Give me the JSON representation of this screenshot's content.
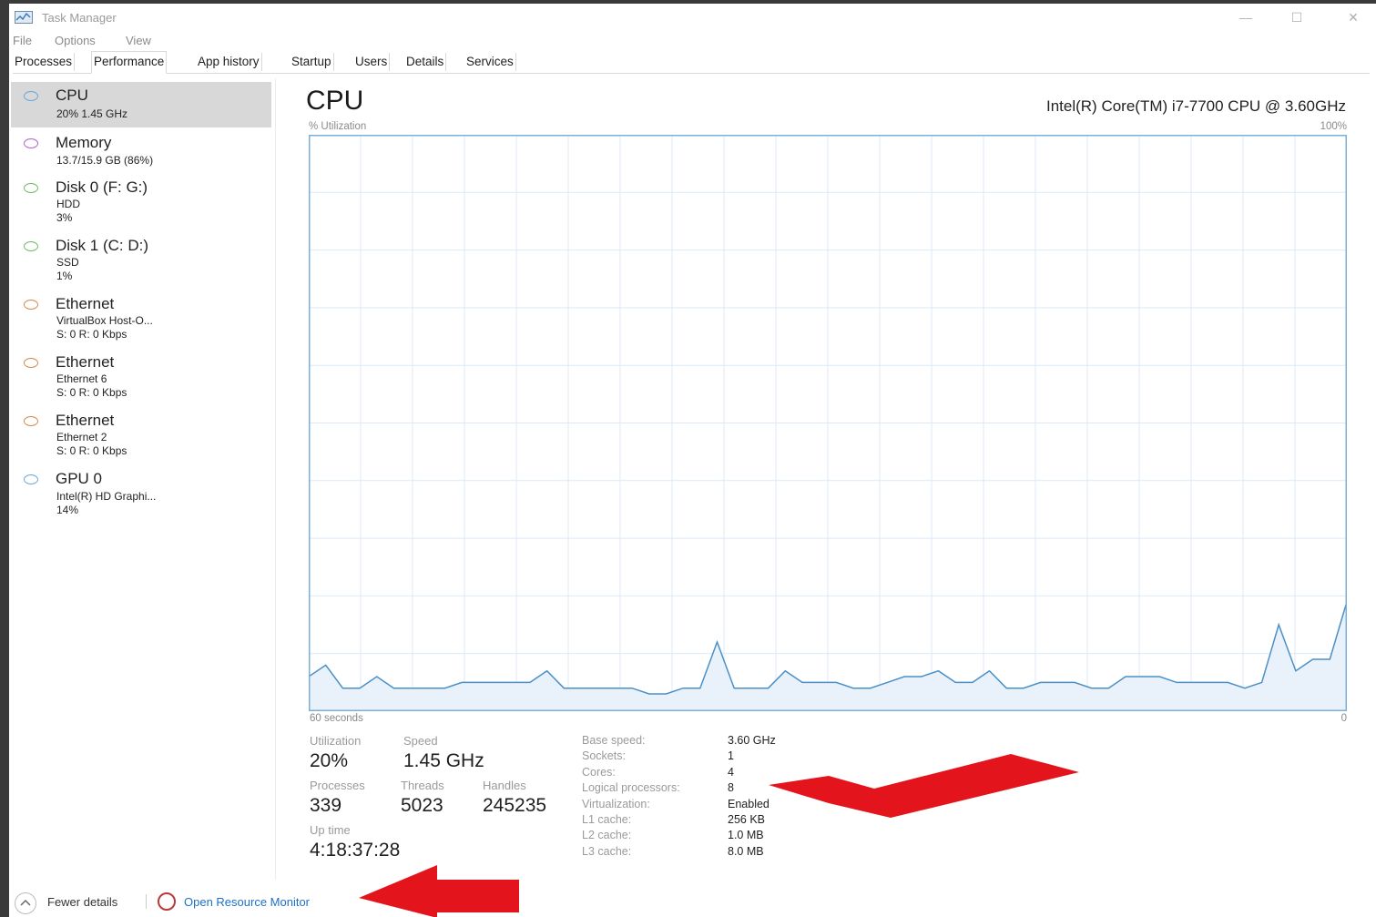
{
  "window": {
    "title": "Task Manager"
  },
  "menu": [
    "File",
    "Options",
    "View"
  ],
  "tabs": [
    "Processes",
    "Performance",
    "App history",
    "Startup",
    "Users",
    "Details",
    "Services"
  ],
  "sidebar": {
    "items": [
      {
        "title": "CPU",
        "lines": [
          "20%  1.45 GHz"
        ],
        "color": "#6aa8dc",
        "selected": true
      },
      {
        "title": "Memory",
        "lines": [
          "13.7/15.9 GB (86%)"
        ],
        "color": "#b45fd0"
      },
      {
        "title": "Disk 0 (F: G:)",
        "lines": [
          "HDD",
          "3%"
        ],
        "color": "#6cbf5f"
      },
      {
        "title": "Disk 1 (C: D:)",
        "lines": [
          "SSD",
          "1%"
        ],
        "color": "#6cbf5f"
      },
      {
        "title": "Ethernet",
        "lines": [
          "VirtualBox Host-O...",
          "S: 0 R: 0 Kbps"
        ],
        "color": "#d68a4c"
      },
      {
        "title": "Ethernet",
        "lines": [
          "Ethernet 6",
          "S: 0 R: 0 Kbps"
        ],
        "color": "#d68a4c"
      },
      {
        "title": "Ethernet",
        "lines": [
          "Ethernet 2",
          "S: 0 R: 0 Kbps"
        ],
        "color": "#d68a4c"
      },
      {
        "title": "GPU 0",
        "lines": [
          "Intel(R) HD Graphi...",
          "14%"
        ],
        "color": "#6aa8dc"
      }
    ]
  },
  "main": {
    "title": "CPU",
    "cpu_name": "Intel(R) Core(TM) i7-7700 CPU @ 3.60GHz",
    "y_axis_label": "% Utilization",
    "y_max_label": "100%",
    "x_left_label": "60 seconds",
    "x_right_label": "0"
  },
  "stats": {
    "utilization_label": "Utilization",
    "utilization": "20%",
    "speed_label": "Speed",
    "speed": "1.45 GHz",
    "processes_label": "Processes",
    "processes": "339",
    "threads_label": "Threads",
    "threads": "5023",
    "handles_label": "Handles",
    "handles": "245235",
    "uptime_label": "Up time",
    "uptime": "4:18:37:28"
  },
  "details": [
    {
      "label": "Base speed:",
      "value": "3.60 GHz"
    },
    {
      "label": "Sockets:",
      "value": "1"
    },
    {
      "label": "Cores:",
      "value": "4"
    },
    {
      "label": "Logical processors:",
      "value": "8"
    },
    {
      "label": "Virtualization:",
      "value": "Enabled"
    },
    {
      "label": "L1 cache:",
      "value": "256 KB"
    },
    {
      "label": "L2 cache:",
      "value": "1.0 MB"
    },
    {
      "label": "L3 cache:",
      "value": "8.0 MB"
    }
  ],
  "footer": {
    "fewer_details": "Fewer details",
    "open_resource_monitor": "Open Resource Monitor"
  },
  "colors": {
    "graph_line": "#4a90c8",
    "graph_fill": "#e9f2fa",
    "grid": "#dce9f5",
    "link": "#1e6fc9",
    "arrow": "#e3141b"
  },
  "chart_data": {
    "type": "area",
    "x": [
      60,
      59,
      58,
      57,
      56,
      55,
      54,
      53,
      52,
      51,
      50,
      49,
      48,
      47,
      46,
      45,
      44,
      43,
      42,
      41,
      40,
      39,
      38,
      37,
      36,
      35,
      34,
      33,
      32,
      31,
      30,
      29,
      28,
      27,
      26,
      25,
      24,
      23,
      22,
      21,
      20,
      19,
      18,
      17,
      17,
      16,
      15,
      14,
      13,
      12,
      11,
      10,
      9,
      8,
      7,
      6,
      5,
      4,
      3,
      2,
      1,
      0
    ],
    "values": [
      6,
      8,
      4,
      4,
      6,
      4,
      4,
      4,
      4,
      5,
      5,
      5,
      5,
      5,
      7,
      4,
      4,
      4,
      4,
      4,
      3,
      3,
      4,
      4,
      12,
      4,
      4,
      4,
      7,
      5,
      5,
      5,
      4,
      4,
      5,
      6,
      6,
      7,
      5,
      5,
      7,
      4,
      4,
      5,
      5,
      5,
      4,
      4,
      6,
      6,
      6,
      5,
      5,
      5,
      5,
      4,
      5,
      15,
      7,
      9,
      9,
      19
    ],
    "ylim": [
      0,
      100
    ],
    "xlabel": "60 seconds",
    "ylabel": "% Utilization"
  }
}
